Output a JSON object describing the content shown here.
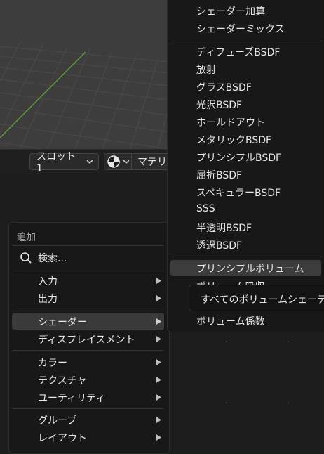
{
  "header": {
    "slot_label": "スロット1",
    "material_label": "マテリ"
  },
  "add_menu": {
    "title": "追加",
    "search_label": "検索...",
    "items": [
      {
        "label": "入力"
      },
      {
        "label": "出力"
      },
      {
        "label": "シェーダー",
        "active": true
      },
      {
        "label": "ディスプレイスメント"
      },
      {
        "label": "カラー"
      },
      {
        "label": "テクスチャ"
      },
      {
        "label": "ユーティリティ"
      },
      {
        "label": "グループ"
      },
      {
        "label": "レイアウト"
      }
    ]
  },
  "shader_submenu": {
    "items": [
      "シェーダー加算",
      "シェーダーミックス",
      "ディフューズBSDF",
      "放射",
      "グラスBSDF",
      "光沢BSDF",
      "ホールドアウト",
      "メタリックBSDF",
      "プリンシプルBSDF",
      "屈折BSDF",
      "スペキュラーBSDF",
      "SSS",
      "半透明BSDF",
      "透過BSDF",
      "プリンシプルボリューム",
      "ボリューム吸収",
      "ボリューム係数"
    ],
    "highlighted": "プリンシプルボリューム"
  },
  "tooltip": {
    "text": "すべてのボリュームシェーディング"
  },
  "colors": {
    "menu_bg": "#181818",
    "highlight": "#3c3c3c",
    "viewport_bg": "#3d3d3d",
    "axis_green": "#6a9a3a"
  }
}
